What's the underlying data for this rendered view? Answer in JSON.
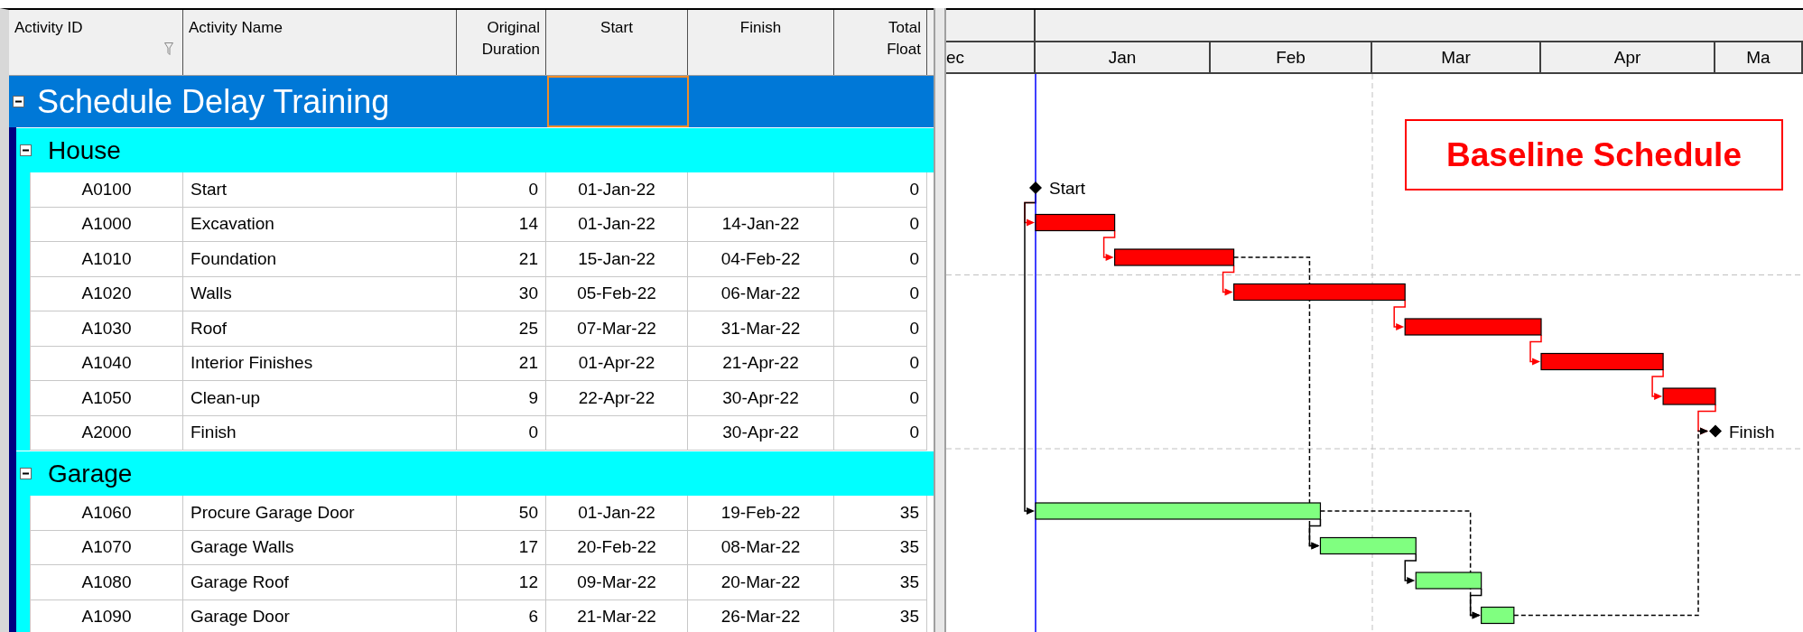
{
  "columns": [
    {
      "label": "Activity ID",
      "filter": true
    },
    {
      "label": "Activity Name",
      "filter": false
    },
    {
      "label": "Original Duration",
      "filter": false
    },
    {
      "label": "Start",
      "filter": false
    },
    {
      "label": "Finish",
      "filter": false
    },
    {
      "label": "Total Float",
      "filter": false
    }
  ],
  "project": {
    "name": "Schedule Delay Training",
    "expanded": true,
    "start_cell_focused": true
  },
  "groups": [
    {
      "name": "House",
      "expanded": true,
      "color": "#ff0000",
      "activities": [
        {
          "kind": "milestone",
          "id": "A0100",
          "name": "Start",
          "duration": "0",
          "start": "01-Jan-22",
          "float": "0",
          "bar_label": "Start"
        },
        {
          "kind": "task",
          "id": "A1000",
          "name": "Excavation",
          "duration": "14",
          "start": "01-Jan-22",
          "finish": "14-Jan-22",
          "float": "0"
        },
        {
          "kind": "task",
          "id": "A1010",
          "name": "Foundation",
          "duration": "21",
          "start": "15-Jan-22",
          "finish": "04-Feb-22",
          "float": "0"
        },
        {
          "kind": "task",
          "id": "A1020",
          "name": "Walls",
          "duration": "30",
          "start": "05-Feb-22",
          "finish": "06-Mar-22",
          "float": "0"
        },
        {
          "kind": "task",
          "id": "A1030",
          "name": "Roof",
          "duration": "25",
          "start": "07-Mar-22",
          "finish": "31-Mar-22",
          "float": "0"
        },
        {
          "kind": "task",
          "id": "A1040",
          "name": "Interior Finishes",
          "duration": "21",
          "start": "01-Apr-22",
          "finish": "21-Apr-22",
          "float": "0"
        },
        {
          "kind": "task",
          "id": "A1050",
          "name": "Clean-up",
          "duration": "9",
          "start": "22-Apr-22",
          "finish": "30-Apr-22",
          "float": "0"
        },
        {
          "kind": "milestone",
          "id": "A2000",
          "name": "Finish",
          "duration": "0",
          "finish": "30-Apr-22",
          "float": "0",
          "bar_label": "Finish"
        }
      ]
    },
    {
      "name": "Garage",
      "expanded": true,
      "color": "#80ff80",
      "activities": [
        {
          "kind": "task",
          "id": "A1060",
          "name": "Procure Garage Door",
          "duration": "50",
          "start": "01-Jan-22",
          "finish": "19-Feb-22",
          "float": "35"
        },
        {
          "kind": "task",
          "id": "A1070",
          "name": "Garage Walls",
          "duration": "17",
          "start": "20-Feb-22",
          "finish": "08-Mar-22",
          "float": "35"
        },
        {
          "kind": "task",
          "id": "A1080",
          "name": "Garage Roof",
          "duration": "12",
          "start": "09-Mar-22",
          "finish": "20-Mar-22",
          "float": "35"
        },
        {
          "kind": "task",
          "id": "A1090",
          "name": "Garage Door",
          "duration": "6",
          "start": "21-Mar-22",
          "finish": "26-Mar-22",
          "float": "35"
        }
      ]
    }
  ],
  "timeline": {
    "months": [
      "ec",
      "Jan",
      "Feb",
      "Mar",
      "Apr",
      "Ma"
    ]
  },
  "links": [
    {
      "critical": true,
      "dashed": false
    },
    {
      "critical": true,
      "dashed": false
    },
    {
      "critical": true,
      "dashed": false
    },
    {
      "critical": true,
      "dashed": false
    },
    {
      "critical": true,
      "dashed": false
    },
    {
      "critical": true,
      "dashed": false
    },
    {
      "critical": true,
      "dashed": false
    },
    {
      "critical": false,
      "dashed": false
    },
    {
      "critical": false,
      "dashed": false
    },
    {
      "critical": false,
      "dashed": false
    },
    {
      "critical": false,
      "dashed": false
    },
    {
      "critical": false,
      "dashed": true
    },
    {
      "critical": false,
      "dashed": true
    },
    {
      "critical": false,
      "dashed": true
    }
  ],
  "annotation": {
    "text": "Baseline Schedule"
  }
}
